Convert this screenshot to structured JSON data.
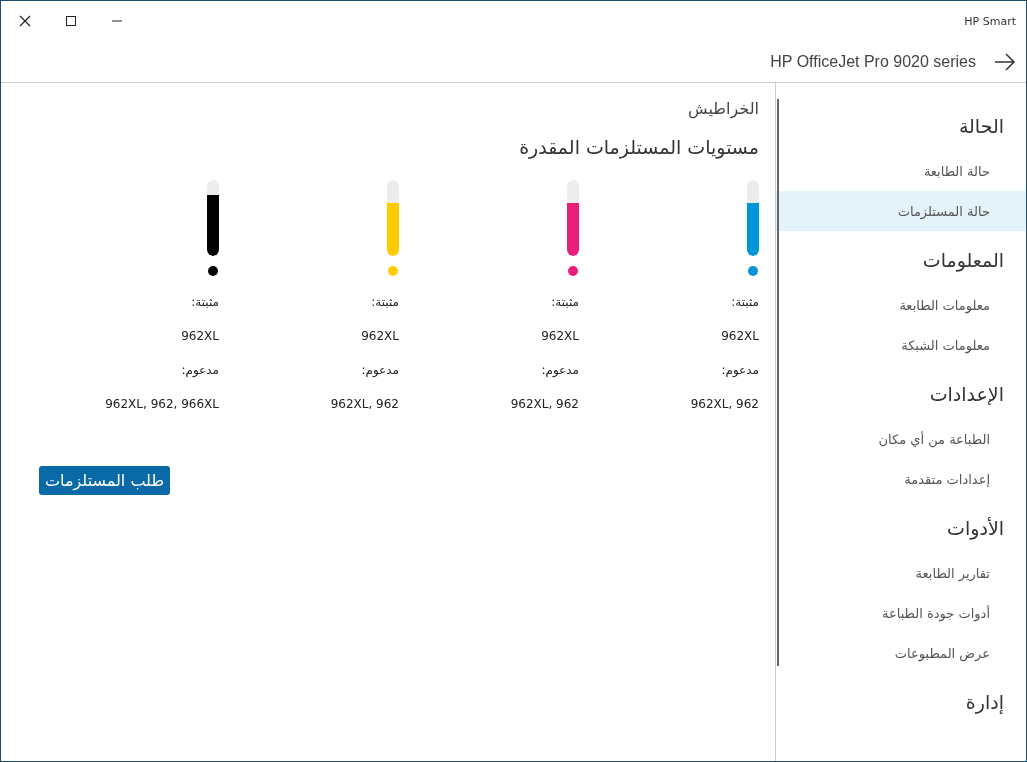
{
  "window": {
    "title": "HP Smart"
  },
  "header": {
    "printer": "HP OfficeJet Pro 9020 series"
  },
  "main": {
    "section": "الخراطيش",
    "heading": "مستويات المستلزمات المقدرة",
    "cartridges": [
      {
        "color": "#0096d6",
        "level": 0.7,
        "installed_label": "مثبتة:",
        "installed": "962XL",
        "supported_label": "مدعوم:",
        "supported": "962XL, 962"
      },
      {
        "color": "#e91e78",
        "level": 0.7,
        "installed_label": "مثبتة:",
        "installed": "962XL",
        "supported_label": "مدعوم:",
        "supported": "962XL, 962"
      },
      {
        "color": "#ffcc00",
        "level": 0.7,
        "installed_label": "مثبتة:",
        "installed": "962XL",
        "supported_label": "مدعوم:",
        "supported": "962XL, 962"
      },
      {
        "color": "#000000",
        "level": 0.8,
        "installed_label": "مثبتة:",
        "installed": "962XL",
        "supported_label": "مدعوم:",
        "supported": "962XL, 962, 966XL"
      }
    ],
    "order_button": "طلب المستلزمات"
  },
  "sidebar": {
    "groups": [
      {
        "title": "الحالة",
        "items": [
          {
            "label": "حالة الطابعة",
            "selected": false
          },
          {
            "label": "حالة المستلزمات",
            "selected": true
          }
        ]
      },
      {
        "title": "المعلومات",
        "items": [
          {
            "label": "معلومات الطابعة",
            "selected": false
          },
          {
            "label": "معلومات الشبكة",
            "selected": false
          }
        ]
      },
      {
        "title": "الإعدادات",
        "items": [
          {
            "label": "الطباعة من أي مكان",
            "selected": false
          },
          {
            "label": "إعدادات متقدمة",
            "selected": false
          }
        ]
      },
      {
        "title": "الأدوات",
        "items": [
          {
            "label": "تقارير الطابعة",
            "selected": false
          },
          {
            "label": "أدوات جودة الطباعة",
            "selected": false
          },
          {
            "label": "عرض المطبوعات",
            "selected": false
          }
        ]
      },
      {
        "title": "إدارة"
      }
    ]
  }
}
